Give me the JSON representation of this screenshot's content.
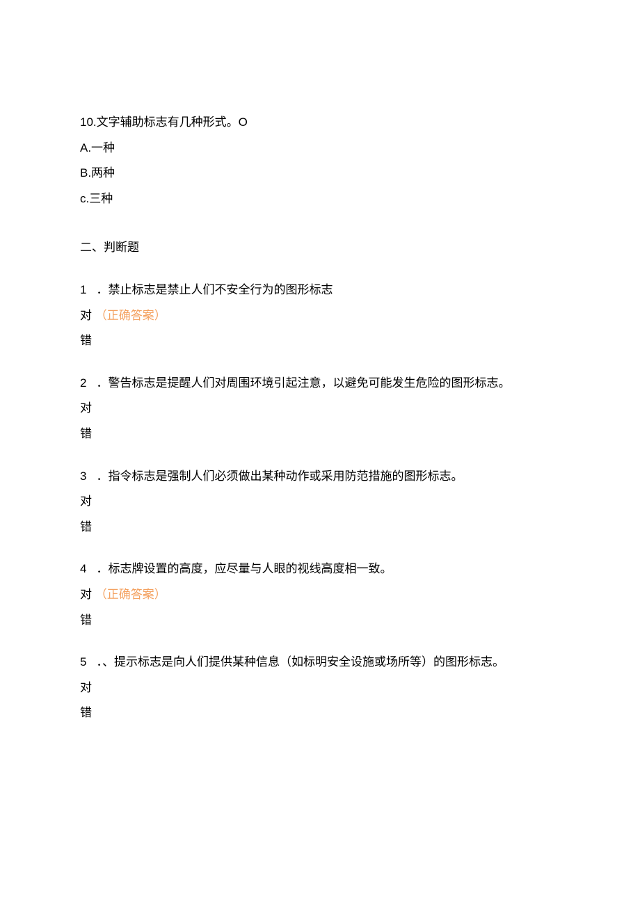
{
  "q10": {
    "text": "10.文字辅助标志有几种形式。O",
    "optA": "A.一种",
    "optB": "B.两种",
    "optC": "c.三种"
  },
  "section2_heading": "二、判断题",
  "tf1": {
    "num": "1",
    "stem": "．禁止标志是禁止人们不安全行为的图形标志",
    "true_label": "对",
    "true_tag": "（正确答案）",
    "false_label": "错"
  },
  "tf2": {
    "num": "2",
    "stem": "．警告标志是提醒人们对周围环境引起注意，以避免可能发生危险的图形标志。",
    "true_label": "对",
    "false_label": "错"
  },
  "tf3": {
    "num": "3",
    "stem": "．指令标志是强制人们必须做出某种动作或采用防范措施的图形标志。",
    "true_label": "对",
    "false_label": "错"
  },
  "tf4": {
    "num": "4",
    "stem": "．标志牌设置的高度，应尽量与人眼的视线高度相一致。",
    "true_label": "对",
    "true_tag": "（正确答案）",
    "false_label": "错"
  },
  "tf5": {
    "num": "5",
    "stem": "．、提示标志是向人们提供某种信息（如标明安全设施或场所等）的图形标志。",
    "true_label": "对",
    "false_label": "错"
  }
}
